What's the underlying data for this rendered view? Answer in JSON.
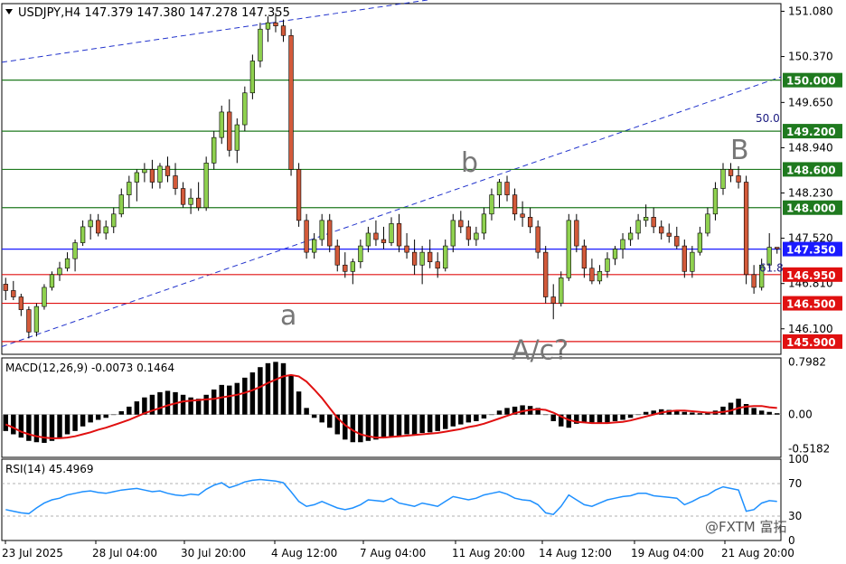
{
  "chart_data": {
    "type": "candlestick",
    "symbol_header": "USDJPY,H4  147.379 147.380 147.278 147.355",
    "price_axis": {
      "ylim": [
        145.7,
        151.2
      ],
      "ticks": [
        "151.080",
        "150.370",
        "149.650",
        "148.940",
        "148.230",
        "147.520",
        "146.810",
        "146.100"
      ]
    },
    "levels": [
      {
        "label": "150.000",
        "value": 150.0,
        "color": "#1f7a1f"
      },
      {
        "label": "149.200",
        "value": 149.2,
        "color": "#1f7a1f"
      },
      {
        "label": "148.600",
        "value": 148.6,
        "color": "#1f7a1f"
      },
      {
        "label": "148.000",
        "value": 148.0,
        "color": "#1f7a1f"
      },
      {
        "label": "147.350",
        "value": 147.35,
        "color": "#1a1aff"
      },
      {
        "label": "146.950",
        "value": 146.95,
        "color": "#e01010"
      },
      {
        "label": "146.500",
        "value": 146.5,
        "color": "#e01010"
      },
      {
        "label": "145.900",
        "value": 145.9,
        "color": "#e01010"
      }
    ],
    "fib_labels": [
      "50.0",
      "61.8"
    ],
    "wave_labels": [
      "a",
      "b",
      "A/c?",
      "B"
    ],
    "candles": [
      [
        146.8,
        146.9,
        146.55,
        146.7
      ],
      [
        146.7,
        146.85,
        146.55,
        146.6
      ],
      [
        146.6,
        146.65,
        146.3,
        146.4
      ],
      [
        146.4,
        146.45,
        145.95,
        146.05
      ],
      [
        146.05,
        146.5,
        145.98,
        146.45
      ],
      [
        146.45,
        146.8,
        146.4,
        146.75
      ],
      [
        146.75,
        147.0,
        146.7,
        146.95
      ],
      [
        146.95,
        147.15,
        146.85,
        147.05
      ],
      [
        147.05,
        147.3,
        147.0,
        147.2
      ],
      [
        147.2,
        147.5,
        147.0,
        147.45
      ],
      [
        147.45,
        147.8,
        147.4,
        147.7
      ],
      [
        147.7,
        147.9,
        147.5,
        147.8
      ],
      [
        147.8,
        147.9,
        147.55,
        147.6
      ],
      [
        147.6,
        147.8,
        147.5,
        147.7
      ],
      [
        147.7,
        148.0,
        147.6,
        147.9
      ],
      [
        147.9,
        148.3,
        147.85,
        148.2
      ],
      [
        148.2,
        148.5,
        148.0,
        148.4
      ],
      [
        148.4,
        148.6,
        148.1,
        148.55
      ],
      [
        148.55,
        148.7,
        148.4,
        148.6
      ],
      [
        148.6,
        148.75,
        148.3,
        148.4
      ],
      [
        148.4,
        148.7,
        148.3,
        148.65
      ],
      [
        148.65,
        148.8,
        148.4,
        148.5
      ],
      [
        148.5,
        148.7,
        148.2,
        148.3
      ],
      [
        148.3,
        148.4,
        148.0,
        148.05
      ],
      [
        148.05,
        148.3,
        147.9,
        148.15
      ],
      [
        148.15,
        148.4,
        147.95,
        148.0
      ],
      [
        148.0,
        148.8,
        147.95,
        148.7
      ],
      [
        148.7,
        149.2,
        148.6,
        149.1
      ],
      [
        149.1,
        149.6,
        149.0,
        149.5
      ],
      [
        149.5,
        149.7,
        148.8,
        148.9
      ],
      [
        148.9,
        149.4,
        148.7,
        149.3
      ],
      [
        149.3,
        149.9,
        149.2,
        149.8
      ],
      [
        149.8,
        150.4,
        149.7,
        150.3
      ],
      [
        150.3,
        150.9,
        150.2,
        150.8
      ],
      [
        150.8,
        151.0,
        150.6,
        150.9
      ],
      [
        150.9,
        151.05,
        150.75,
        150.85
      ],
      [
        150.85,
        150.95,
        150.6,
        150.7
      ],
      [
        150.7,
        150.8,
        148.5,
        148.6
      ],
      [
        148.6,
        148.7,
        147.7,
        147.8
      ],
      [
        147.8,
        147.9,
        147.2,
        147.3
      ],
      [
        147.3,
        147.6,
        147.2,
        147.5
      ],
      [
        147.5,
        147.9,
        147.4,
        147.8
      ],
      [
        147.8,
        147.9,
        147.3,
        147.4
      ],
      [
        147.4,
        147.5,
        147.0,
        147.1
      ],
      [
        147.1,
        147.3,
        146.9,
        147.0
      ],
      [
        147.0,
        147.2,
        146.8,
        147.15
      ],
      [
        147.15,
        147.5,
        147.05,
        147.4
      ],
      [
        147.4,
        147.7,
        147.3,
        147.6
      ],
      [
        147.6,
        147.8,
        147.4,
        147.5
      ],
      [
        147.5,
        147.7,
        147.35,
        147.45
      ],
      [
        147.45,
        147.85,
        147.4,
        147.75
      ],
      [
        147.75,
        147.9,
        147.3,
        147.4
      ],
      [
        147.4,
        147.6,
        147.2,
        147.3
      ],
      [
        147.3,
        147.5,
        146.95,
        147.1
      ],
      [
        147.1,
        147.4,
        146.8,
        147.3
      ],
      [
        147.3,
        147.5,
        147.05,
        147.15
      ],
      [
        147.15,
        147.3,
        146.9,
        147.05
      ],
      [
        147.05,
        147.5,
        147.0,
        147.4
      ],
      [
        147.4,
        147.9,
        147.3,
        147.8
      ],
      [
        147.8,
        147.95,
        147.6,
        147.7
      ],
      [
        147.7,
        147.8,
        147.4,
        147.5
      ],
      [
        147.5,
        147.7,
        147.4,
        147.6
      ],
      [
        147.6,
        148.0,
        147.5,
        147.9
      ],
      [
        147.9,
        148.3,
        147.8,
        148.2
      ],
      [
        148.2,
        148.45,
        148.0,
        148.4
      ],
      [
        148.4,
        148.5,
        148.1,
        148.2
      ],
      [
        148.2,
        148.3,
        147.8,
        147.9
      ],
      [
        147.9,
        148.1,
        147.7,
        147.85
      ],
      [
        147.85,
        148.0,
        147.6,
        147.7
      ],
      [
        147.7,
        147.8,
        147.2,
        147.3
      ],
      [
        147.3,
        147.4,
        146.5,
        146.6
      ],
      [
        146.6,
        146.8,
        146.25,
        146.5
      ],
      [
        146.5,
        147.0,
        146.45,
        146.9
      ],
      [
        146.9,
        147.9,
        146.85,
        147.8
      ],
      [
        147.8,
        147.9,
        147.3,
        147.4
      ],
      [
        147.4,
        147.5,
        146.9,
        147.05
      ],
      [
        147.05,
        147.2,
        146.8,
        146.85
      ],
      [
        146.85,
        147.1,
        146.8,
        147.0
      ],
      [
        147.0,
        147.3,
        146.9,
        147.2
      ],
      [
        147.2,
        147.4,
        147.1,
        147.35
      ],
      [
        147.35,
        147.6,
        147.2,
        147.5
      ],
      [
        147.5,
        147.7,
        147.4,
        147.6
      ],
      [
        147.6,
        147.9,
        147.5,
        147.8
      ],
      [
        147.8,
        148.05,
        147.7,
        147.85
      ],
      [
        147.85,
        148.0,
        147.6,
        147.7
      ],
      [
        147.7,
        147.8,
        147.5,
        147.6
      ],
      [
        147.6,
        147.75,
        147.45,
        147.55
      ],
      [
        147.55,
        147.7,
        147.35,
        147.4
      ],
      [
        147.4,
        147.5,
        146.9,
        147.0
      ],
      [
        147.0,
        147.4,
        146.9,
        147.3
      ],
      [
        147.3,
        147.7,
        147.25,
        147.6
      ],
      [
        147.6,
        148.0,
        147.55,
        147.9
      ],
      [
        147.9,
        148.4,
        147.8,
        148.3
      ],
      [
        148.3,
        148.7,
        148.2,
        148.6
      ],
      [
        148.6,
        148.7,
        148.4,
        148.5
      ],
      [
        148.5,
        148.65,
        148.3,
        148.4
      ],
      [
        148.4,
        148.5,
        146.8,
        146.95
      ],
      [
        146.95,
        147.1,
        146.65,
        146.75
      ],
      [
        146.75,
        147.2,
        146.7,
        147.1
      ],
      [
        147.1,
        147.6,
        147.05,
        147.379
      ],
      [
        147.379,
        147.38,
        147.278,
        147.355
      ]
    ],
    "macd": {
      "label": "MACD(12,26,9) -0.0073 0.1464",
      "ylim": [
        -0.65,
        0.86
      ],
      "ticks": [
        "0.7982",
        "0.00",
        "-0.5182"
      ],
      "hist": [
        -0.25,
        -0.3,
        -0.35,
        -0.4,
        -0.42,
        -0.43,
        -0.4,
        -0.35,
        -0.3,
        -0.25,
        -0.18,
        -0.12,
        -0.08,
        -0.05,
        0.0,
        0.05,
        0.12,
        0.2,
        0.26,
        0.3,
        0.34,
        0.36,
        0.34,
        0.3,
        0.26,
        0.24,
        0.3,
        0.38,
        0.45,
        0.44,
        0.48,
        0.56,
        0.64,
        0.72,
        0.78,
        0.8,
        0.78,
        0.6,
        0.35,
        0.1,
        -0.05,
        -0.12,
        -0.2,
        -0.3,
        -0.38,
        -0.42,
        -0.42,
        -0.4,
        -0.38,
        -0.36,
        -0.33,
        -0.32,
        -0.3,
        -0.3,
        -0.28,
        -0.27,
        -0.25,
        -0.22,
        -0.18,
        -0.15,
        -0.12,
        -0.1,
        -0.06,
        0.0,
        0.06,
        0.1,
        0.12,
        0.14,
        0.13,
        0.1,
        0.0,
        -0.1,
        -0.18,
        -0.2,
        -0.14,
        -0.12,
        -0.13,
        -0.13,
        -0.12,
        -0.1,
        -0.08,
        -0.05,
        0.0,
        0.04,
        0.06,
        0.08,
        0.07,
        0.06,
        0.04,
        0.03,
        0.02,
        0.03,
        0.06,
        0.12,
        0.18,
        0.24,
        0.16,
        0.1,
        0.06,
        0.04,
        0.02
      ],
      "signal": [
        -0.15,
        -0.2,
        -0.26,
        -0.3,
        -0.33,
        -0.35,
        -0.36,
        -0.36,
        -0.35,
        -0.33,
        -0.3,
        -0.27,
        -0.23,
        -0.2,
        -0.16,
        -0.12,
        -0.08,
        -0.03,
        0.02,
        0.06,
        0.1,
        0.14,
        0.17,
        0.2,
        0.21,
        0.22,
        0.23,
        0.24,
        0.26,
        0.28,
        0.3,
        0.33,
        0.37,
        0.42,
        0.48,
        0.53,
        0.58,
        0.6,
        0.58,
        0.5,
        0.38,
        0.25,
        0.1,
        -0.05,
        -0.16,
        -0.24,
        -0.3,
        -0.33,
        -0.35,
        -0.35,
        -0.34,
        -0.33,
        -0.32,
        -0.31,
        -0.3,
        -0.29,
        -0.28,
        -0.26,
        -0.24,
        -0.22,
        -0.19,
        -0.17,
        -0.14,
        -0.1,
        -0.06,
        -0.02,
        0.02,
        0.05,
        0.07,
        0.08,
        0.07,
        0.03,
        -0.03,
        -0.08,
        -0.11,
        -0.12,
        -0.13,
        -0.13,
        -0.13,
        -0.12,
        -0.11,
        -0.09,
        -0.06,
        -0.03,
        0.0,
        0.03,
        0.05,
        0.06,
        0.06,
        0.05,
        0.04,
        0.03,
        0.03,
        0.04,
        0.06,
        0.1,
        0.12,
        0.13,
        0.13,
        0.11,
        0.1
      ]
    },
    "rsi": {
      "label": "RSI(14) 45.4969",
      "ylim": [
        0,
        100
      ],
      "ticks": [
        "100",
        "70",
        "30",
        "0"
      ],
      "levels": [
        70,
        30
      ],
      "values": [
        38,
        36,
        34,
        33,
        40,
        46,
        50,
        52,
        56,
        58,
        60,
        61,
        59,
        58,
        60,
        62,
        63,
        64,
        62,
        60,
        61,
        58,
        56,
        55,
        57,
        56,
        63,
        68,
        71,
        65,
        68,
        72,
        74,
        75,
        74,
        73,
        71,
        60,
        48,
        42,
        44,
        48,
        44,
        40,
        38,
        40,
        44,
        50,
        49,
        48,
        52,
        46,
        44,
        42,
        46,
        44,
        42,
        48,
        54,
        52,
        50,
        52,
        56,
        58,
        60,
        57,
        52,
        50,
        49,
        44,
        34,
        32,
        42,
        56,
        50,
        44,
        42,
        46,
        50,
        52,
        54,
        55,
        58,
        58,
        55,
        54,
        53,
        52,
        44,
        48,
        53,
        56,
        62,
        66,
        64,
        62,
        36,
        38,
        46,
        49,
        48
      ]
    },
    "time_labels": [
      "23 Jul 2025",
      "28 Jul 04:00",
      "30 Jul 20:00",
      "4 Aug 12:00",
      "7 Aug 04:00",
      "11 Aug 20:00",
      "14 Aug 12:00",
      "19 Aug 04:00",
      "21 Aug 20:00"
    ],
    "colors": {
      "bull": "#8fd14f",
      "bear": "#d35a3a",
      "wick": "#000000",
      "macd_hist": "#000000",
      "signal": "#e01010",
      "rsi": "#1e90ff",
      "channel": "#2233cc"
    },
    "watermark": "@FXTM 富拓"
  }
}
